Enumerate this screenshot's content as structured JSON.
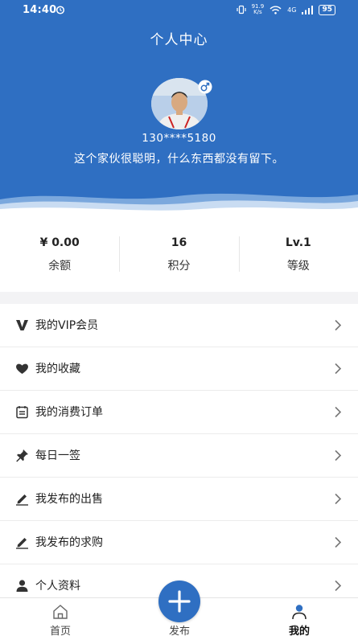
{
  "status_bar": {
    "time": "14:40",
    "net_speed_value": "91.9",
    "net_speed_unit": "K/s",
    "signal_label": "4G",
    "battery": "95"
  },
  "header": {
    "title": "个人中心"
  },
  "profile": {
    "phone": "130****5180",
    "bio": "这个家伙很聪明，什么东西都没有留下。"
  },
  "stats": [
    {
      "value": "¥ 0.00",
      "label": "余额"
    },
    {
      "value": "16",
      "label": "积分"
    },
    {
      "value": "Lv.1",
      "label": "等级"
    }
  ],
  "menu": [
    {
      "icon": "vip-icon",
      "label": "我的VIP会员"
    },
    {
      "icon": "heart-icon",
      "label": "我的收藏"
    },
    {
      "icon": "order-icon",
      "label": "我的消费订单"
    },
    {
      "icon": "pin-icon",
      "label": "每日一签"
    },
    {
      "icon": "edit-icon",
      "label": "我发布的出售"
    },
    {
      "icon": "edit-icon",
      "label": "我发布的求购"
    },
    {
      "icon": "user-icon",
      "label": "个人资料"
    }
  ],
  "nav": {
    "home": "首页",
    "publish": "发布",
    "mine": "我的"
  },
  "colors": {
    "primary": "#2f6fc2",
    "background": "#f3f3f5"
  }
}
